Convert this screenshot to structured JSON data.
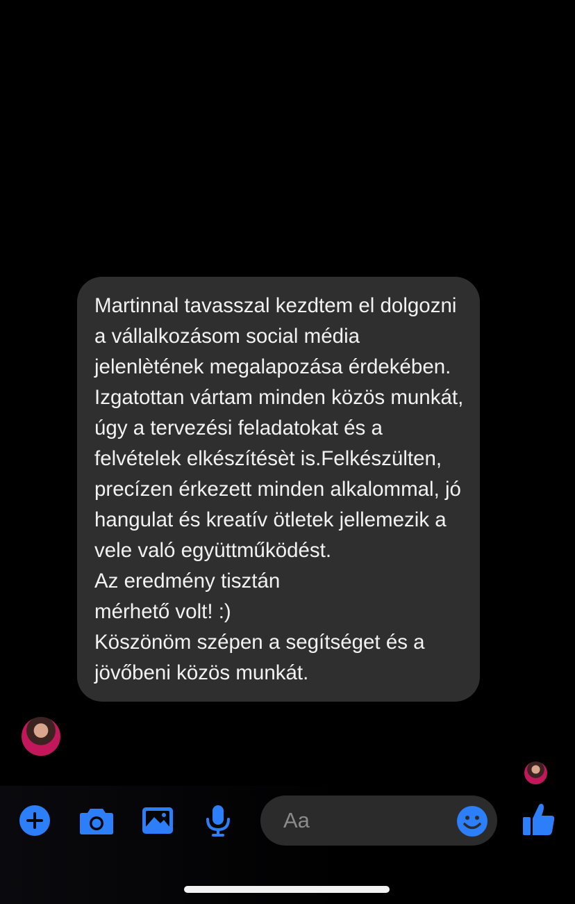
{
  "conversation": {
    "messages": [
      {
        "direction": "incoming",
        "text": "Martinnal tavasszal kezdtem el dolgozni a vállalkozásom social média jelenlètének megalapozása érdekében. Izgatottan vártam minden közös munkát, úgy a tervezési feladatokat és a felvételek elkészítésèt is.Felkészülten, precízen érkezett minden alkalommal, jó hangulat és kreatív ötletek jellemezik a vele való együttműködést.\nAz eredmény tisztán\nmérhető volt! :)\nKöszönöm szépen a segítséget és a jövőbeni közös munkát."
      }
    ]
  },
  "composer": {
    "placeholder": "Aa",
    "accent_color": "#2d7ff9",
    "icons": [
      "plus-icon",
      "camera-icon",
      "gallery-icon",
      "microphone-icon",
      "emoji-icon",
      "thumbs-up-icon"
    ]
  },
  "colors": {
    "background": "#000000",
    "bubble": "#2f2f2f",
    "text": "#f2f2f2"
  }
}
